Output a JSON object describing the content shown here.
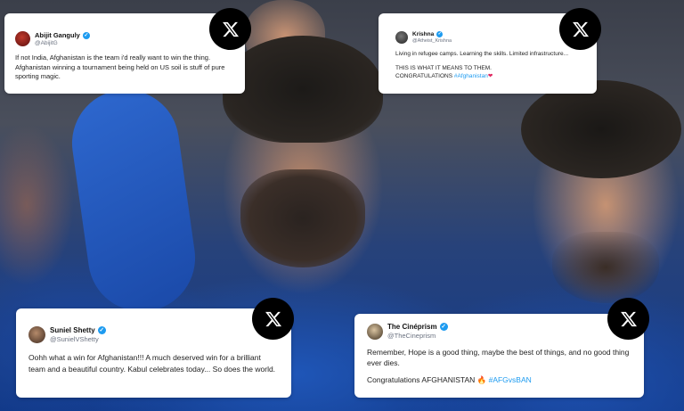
{
  "tweets": [
    {
      "name": "Abijit Ganguly",
      "handle": "@AbijitG",
      "text": "If not India, Afghanistan is the team i'd really want to win the thing. Afghanistan winning a tournament being held on US soil is stuff of pure sporting magic."
    },
    {
      "name": "Krishna",
      "handle": "@Atheist_Krishna",
      "line1": "Living in refugee camps. Learning the skills. Limited infrastructure...",
      "line2": "THIS IS WHAT IT MEANS TO THEM.",
      "line3_prefix": "CONGRATULATIONS ",
      "line3_hashtag": "#Afghanistan",
      "line3_emoji": "❤"
    },
    {
      "name": "Suniel Shetty",
      "handle": "@SunielVShetty",
      "text": "Oohh what a win for Afghanistan!!! A much deserved win for a brilliant team and a beautiful country. Kabul celebrates today... So does the world."
    },
    {
      "name": "The Cinéprism",
      "handle": "@TheCineprism",
      "line1": "Remember, Hope is a good thing, maybe the best of things, and no good thing ever dies.",
      "line2_prefix": "Congratulations AFGHANISTAN ",
      "line2_emoji": "🔥",
      "line2_hashtag": "#AFGvsBAN"
    }
  ],
  "icons": {
    "platform": "x-logo-icon",
    "verified": "verified-badge-icon"
  },
  "colors": {
    "card_bg": "#ffffff",
    "hashtag": "#1d9bf0",
    "verified": "#1d9bf0",
    "x_badge": "#000000"
  }
}
